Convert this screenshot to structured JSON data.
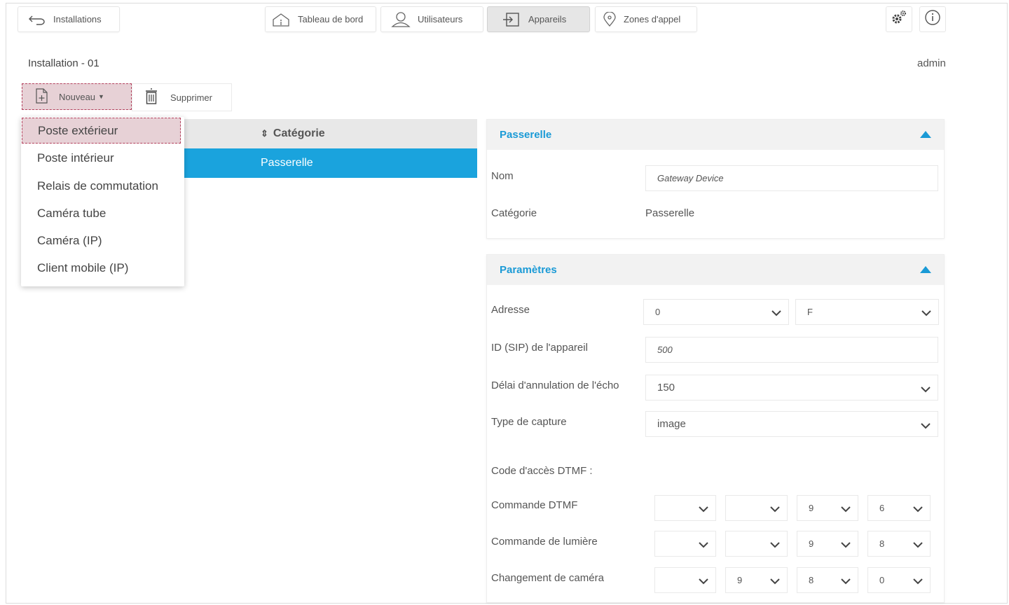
{
  "nav": {
    "installations": "Installations",
    "tabs": [
      {
        "label": "Tableau de bord"
      },
      {
        "label": "Utilisateurs"
      },
      {
        "label": "Appareils"
      },
      {
        "label": "Zones d'appel"
      }
    ]
  },
  "header": {
    "installation": "Installation - 01",
    "user": "admin"
  },
  "toolbar": {
    "new_label": "Nouveau",
    "delete_label": "Supprimer"
  },
  "dropdown": {
    "items": [
      {
        "label": "Poste extérieur"
      },
      {
        "label": "Poste intérieur"
      },
      {
        "label": "Relais de commutation"
      },
      {
        "label": "Caméra tube"
      },
      {
        "label": "Caméra (IP)"
      },
      {
        "label": "Client mobile (IP)"
      }
    ]
  },
  "table": {
    "column": "Catégorie",
    "rows": [
      {
        "category": "Passerelle"
      }
    ]
  },
  "gateway_panel": {
    "title": "Passerelle",
    "name_label": "Nom",
    "name_value": "Gateway Device",
    "category_label": "Catégorie",
    "category_value": "Passerelle"
  },
  "params_panel": {
    "title": "Paramètres",
    "address_label": "Adresse",
    "address_1": "0",
    "address_2": "F",
    "sip_label": "ID (SIP) de l'appareil",
    "sip_value": "500",
    "echo_label": "Délai d'annulation de l'écho",
    "echo_value": "150",
    "capture_label": "Type de capture",
    "capture_value": "image",
    "dtmf_section": "Code d'accès DTMF :",
    "dtmf_rows": [
      {
        "label": "Commande DTMF",
        "values": [
          "",
          "",
          "9",
          "6"
        ]
      },
      {
        "label": "Commande de lumière",
        "values": [
          "",
          "",
          "9",
          "8"
        ]
      },
      {
        "label": "Changement de caméra",
        "values": [
          "",
          "9",
          "8",
          "0"
        ]
      }
    ]
  },
  "colors": {
    "accent": "#1a9ad6",
    "selected_row": "#1aa3dd",
    "highlight": "#e7d1d6",
    "highlight_border": "#b3405c"
  }
}
